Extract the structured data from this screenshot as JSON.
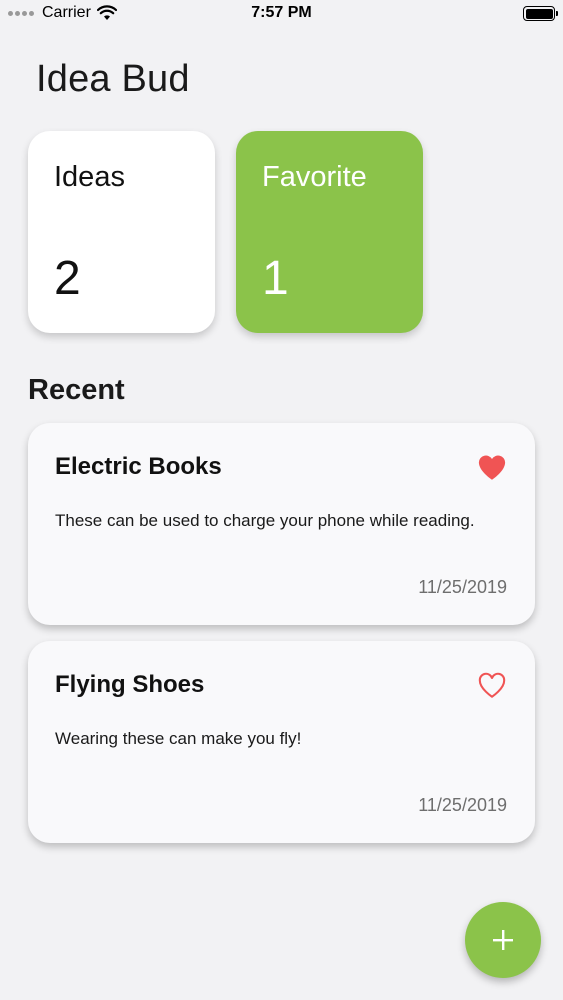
{
  "status_bar": {
    "carrier": "Carrier",
    "time": "7:57 PM"
  },
  "app": {
    "title": "Idea Bud"
  },
  "stats": {
    "ideas": {
      "label": "Ideas",
      "value": "2"
    },
    "favorite": {
      "label": "Favorite",
      "value": "1"
    }
  },
  "recent": {
    "title": "Recent",
    "items": [
      {
        "title": "Electric Books",
        "description": "These can be used to charge your phone while reading.",
        "date": "11/25/2019",
        "favorite": true,
        "icon": "heart-filled-icon"
      },
      {
        "title": "Flying Shoes",
        "description": "Wearing these can make you fly!",
        "date": "11/25/2019",
        "favorite": false,
        "icon": "heart-outline-icon"
      }
    ]
  },
  "fab": {
    "icon": "plus-icon"
  },
  "colors": {
    "accent": "#8bc34a",
    "heart": "#f05454",
    "background": "#f2f2f4"
  }
}
